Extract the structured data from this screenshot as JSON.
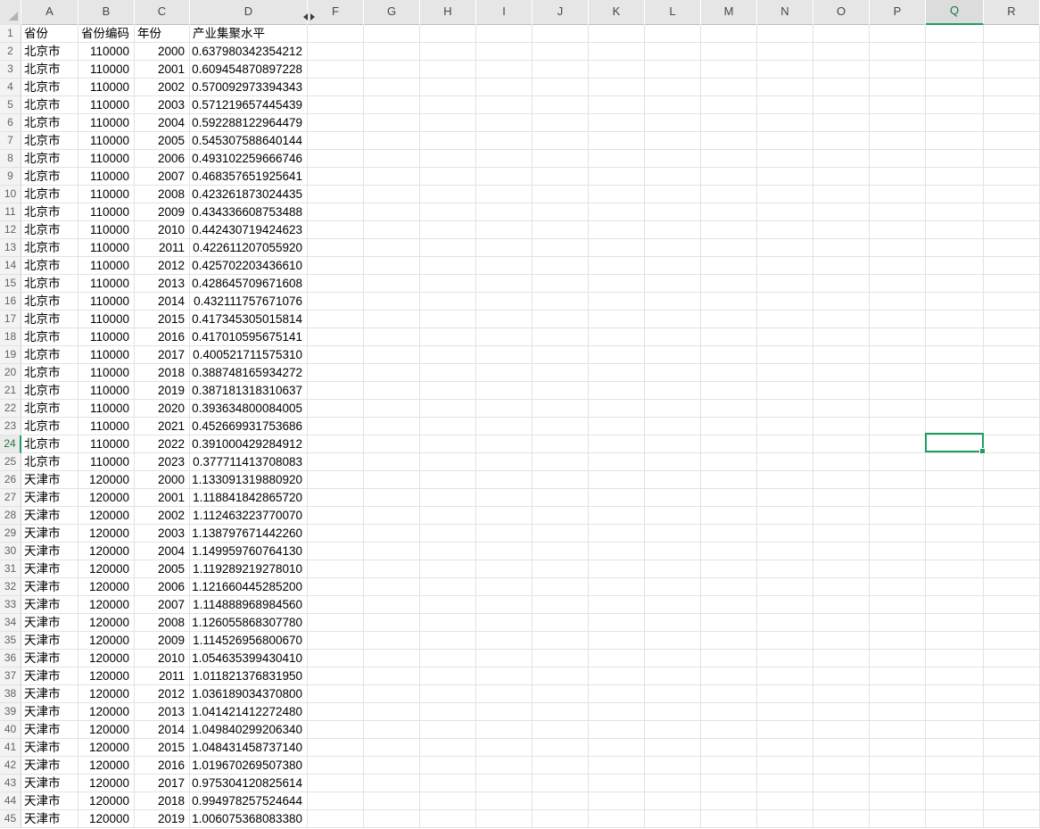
{
  "app": "spreadsheet",
  "sheet": {
    "column_letters": [
      "A",
      "B",
      "C",
      "D",
      "F",
      "G",
      "H",
      "I",
      "J",
      "K",
      "L",
      "M",
      "N",
      "O",
      "P",
      "Q",
      "R"
    ],
    "hidden_columns": [
      "E"
    ],
    "hidden_marker_icon": "hidden-column-arrows-icon",
    "visible_row_numbers_first": 1,
    "visible_row_numbers_last": 45,
    "selected_cell": {
      "ref": "Q24",
      "column": "Q",
      "row": 24
    },
    "header_labels": [
      "省份",
      "省份编码",
      "年份",
      "产业集聚水平"
    ],
    "data_rows": [
      [
        "北京市",
        "110000",
        "2000",
        "0.637980342354212"
      ],
      [
        "北京市",
        "110000",
        "2001",
        "0.609454870897228"
      ],
      [
        "北京市",
        "110000",
        "2002",
        "0.570092973394343"
      ],
      [
        "北京市",
        "110000",
        "2003",
        "0.571219657445439"
      ],
      [
        "北京市",
        "110000",
        "2004",
        "0.592288122964479"
      ],
      [
        "北京市",
        "110000",
        "2005",
        "0.545307588640144"
      ],
      [
        "北京市",
        "110000",
        "2006",
        "0.493102259666746"
      ],
      [
        "北京市",
        "110000",
        "2007",
        "0.468357651925641"
      ],
      [
        "北京市",
        "110000",
        "2008",
        "0.423261873024435"
      ],
      [
        "北京市",
        "110000",
        "2009",
        "0.434336608753488"
      ],
      [
        "北京市",
        "110000",
        "2010",
        "0.442430719424623"
      ],
      [
        "北京市",
        "110000",
        "2011",
        "0.422611207055920"
      ],
      [
        "北京市",
        "110000",
        "2012",
        "0.425702203436610"
      ],
      [
        "北京市",
        "110000",
        "2013",
        "0.428645709671608"
      ],
      [
        "北京市",
        "110000",
        "2014",
        "0.432111757671076"
      ],
      [
        "北京市",
        "110000",
        "2015",
        "0.417345305015814"
      ],
      [
        "北京市",
        "110000",
        "2016",
        "0.417010595675141"
      ],
      [
        "北京市",
        "110000",
        "2017",
        "0.400521711575310"
      ],
      [
        "北京市",
        "110000",
        "2018",
        "0.388748165934272"
      ],
      [
        "北京市",
        "110000",
        "2019",
        "0.387181318310637"
      ],
      [
        "北京市",
        "110000",
        "2020",
        "0.393634800084005"
      ],
      [
        "北京市",
        "110000",
        "2021",
        "0.452669931753686"
      ],
      [
        "北京市",
        "110000",
        "2022",
        "0.391000429284912"
      ],
      [
        "北京市",
        "110000",
        "2023",
        "0.377711413708083"
      ],
      [
        "天津市",
        "120000",
        "2000",
        "1.133091319880920"
      ],
      [
        "天津市",
        "120000",
        "2001",
        "1.118841842865720"
      ],
      [
        "天津市",
        "120000",
        "2002",
        "1.112463223770070"
      ],
      [
        "天津市",
        "120000",
        "2003",
        "1.138797671442260"
      ],
      [
        "天津市",
        "120000",
        "2004",
        "1.149959760764130"
      ],
      [
        "天津市",
        "120000",
        "2005",
        "1.119289219278010"
      ],
      [
        "天津市",
        "120000",
        "2006",
        "1.121660445285200"
      ],
      [
        "天津市",
        "120000",
        "2007",
        "1.114888968984560"
      ],
      [
        "天津市",
        "120000",
        "2008",
        "1.126055868307780"
      ],
      [
        "天津市",
        "120000",
        "2009",
        "1.114526956800670"
      ],
      [
        "天津市",
        "120000",
        "2010",
        "1.054635399430410"
      ],
      [
        "天津市",
        "120000",
        "2011",
        "1.011821376831950"
      ],
      [
        "天津市",
        "120000",
        "2012",
        "1.036189034370800"
      ],
      [
        "天津市",
        "120000",
        "2013",
        "1.041421412272480"
      ],
      [
        "天津市",
        "120000",
        "2014",
        "1.049840299206340"
      ],
      [
        "天津市",
        "120000",
        "2015",
        "1.048431458737140"
      ],
      [
        "天津市",
        "120000",
        "2016",
        "1.019670269507380"
      ],
      [
        "天津市",
        "120000",
        "2017",
        "0.975304120825614"
      ],
      [
        "天津市",
        "120000",
        "2018",
        "0.994978257524644"
      ],
      [
        "天津市",
        "120000",
        "2019",
        "1.006075368083380"
      ]
    ]
  },
  "colors": {
    "accent_green": "#1f9d61",
    "accent_green_text": "#217346",
    "header_bg": "#e6e6e6",
    "header_selected_bg": "#dcdcdc",
    "gridline": "#e2e2e2"
  }
}
